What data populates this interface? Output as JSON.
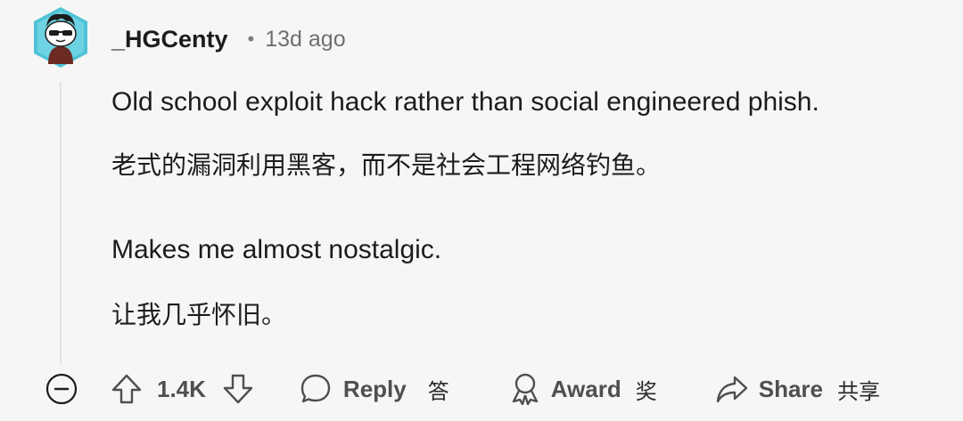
{
  "comment": {
    "author": "_HGCenty",
    "separator": "•",
    "age": "13d ago",
    "lines": [
      "Old school exploit hack rather than social engineered phish.",
      "老式的漏洞利用黑客，而不是社会工程网络钓鱼。",
      "Makes me almost nostalgic.",
      "让我几乎怀旧。"
    ]
  },
  "actions": {
    "vote_count": "1.4K",
    "reply_label": "Reply",
    "reply_cn": "答",
    "award_label": "Award",
    "award_cn": "奖",
    "share_label": "Share",
    "share_cn": "共享"
  },
  "icons": {
    "avatar": "snoo-avatar-with-sunglasses",
    "collapse": "minus-circle-icon",
    "upvote": "arrow-up-icon",
    "downvote": "arrow-down-icon",
    "reply": "speech-bubble-icon",
    "award": "award-ribbon-icon",
    "share": "share-arrow-icon"
  },
  "colors": {
    "background": "#f6f6f6",
    "avatar_bg": "#4fc3d6",
    "text": "#1c1c1c",
    "muted": "#6f6f6f"
  }
}
